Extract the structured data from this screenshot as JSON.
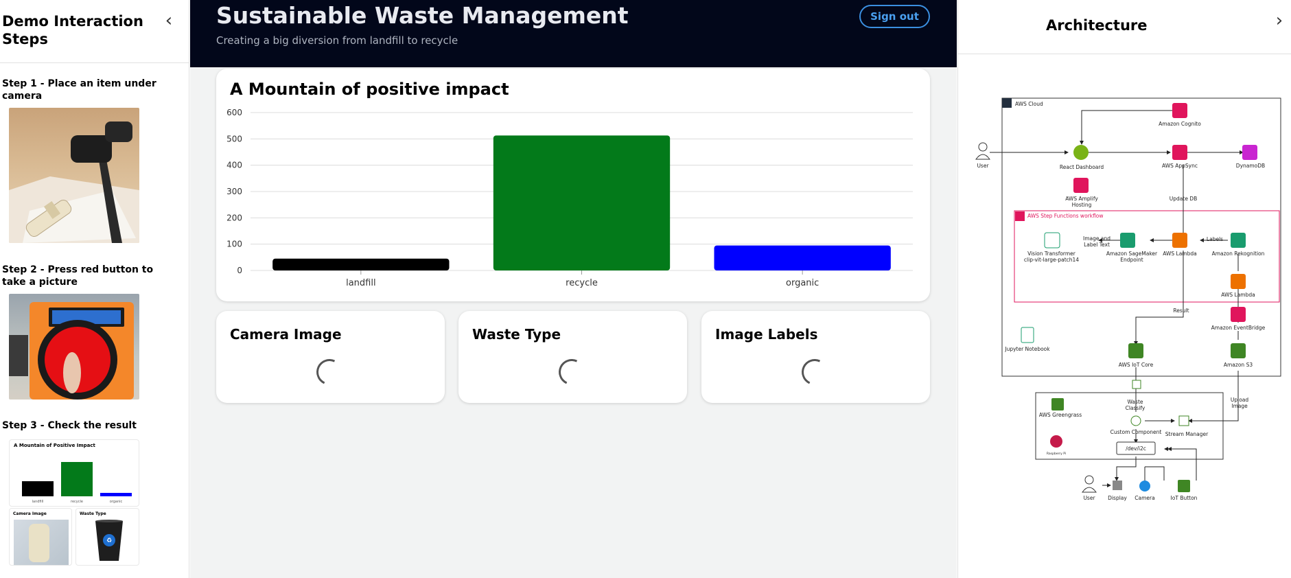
{
  "left_panel": {
    "title": "Demo Interaction Steps",
    "collapse_icon": "chevron-left-icon",
    "steps": [
      {
        "title": "Step 1 - Place an item under camera"
      },
      {
        "title": "Step 2 - Press red button to take a picture"
      },
      {
        "title": "Step 3 - Check the result"
      }
    ],
    "result_thumbnail": {
      "title": "A Mountain of Positive Impact",
      "categories": [
        "landfill",
        "recycle",
        "organic"
      ],
      "values": [
        90,
        200,
        20
      ],
      "camera_label": "Camera Image",
      "waste_label": "Waste Type"
    }
  },
  "header": {
    "title": "Sustainable Waste Management",
    "subtitle": "Creating a big diversion from landfill to recycle",
    "signout_label": "Sign out"
  },
  "chart_card": {
    "title": "A Mountain of positive impact"
  },
  "chart_data": {
    "type": "bar",
    "title": "A Mountain of positive impact",
    "categories": [
      "landfill",
      "recycle",
      "organic"
    ],
    "values": [
      45,
      513,
      95
    ],
    "colors": [
      "#000000",
      "#037a1a",
      "#0000ff"
    ],
    "xlabel": "",
    "ylabel": "",
    "ylim": [
      0,
      600
    ],
    "yticks": [
      0,
      100,
      200,
      300,
      400,
      500,
      600
    ],
    "grid": true
  },
  "cards": [
    {
      "title": "Camera Image",
      "status": "loading"
    },
    {
      "title": "Waste Type",
      "status": "loading"
    },
    {
      "title": "Image Labels",
      "status": "loading"
    }
  ],
  "right_panel": {
    "title": "Architecture",
    "expand_icon": "chevron-right-icon",
    "diagram": {
      "cloud_label": "AWS Cloud",
      "workflow_label": "AWS Step Functions workflow",
      "nodes": {
        "cognito": "Amazon Cognito",
        "user_top": "User",
        "dashboard": "React Dashboard",
        "appsync": "AWS AppSync",
        "dynamodb": "DynamoDB",
        "amplify_1": "AWS Amplify",
        "amplify_2": "Hosting",
        "update_db": "Update DB",
        "vit_1": "Vision Transformer",
        "vit_2": "clip-vit-large-patch14",
        "image_label_1": "Image and",
        "image_label_2": "Label Text",
        "sagemaker_1": "Amazon SageMaker",
        "sagemaker_2": "Endpoint",
        "lambda_1": "AWS Lambda",
        "labels": "Labels",
        "rekognition": "Amazon Rekognition",
        "lambda_2": "AWS Lambda",
        "result": "Result",
        "eventbridge": "Amazon EventBridge",
        "jupyter": "Jupyter Notebook",
        "iot_core": "AWS IoT Core",
        "s3": "Amazon S3",
        "waste_1": "Waste",
        "waste_2": "Classify",
        "upload_1": "Upload",
        "upload_2": "Image",
        "greengrass": "AWS Greengrass",
        "custom": "Custom Component",
        "stream": "Stream Manager",
        "raspberry": "Raspberry Pi",
        "dev": "/dev/i2c",
        "user_bottom": "User",
        "display": "Display",
        "camera": "Camera",
        "iot_button": "IoT Button"
      }
    }
  }
}
